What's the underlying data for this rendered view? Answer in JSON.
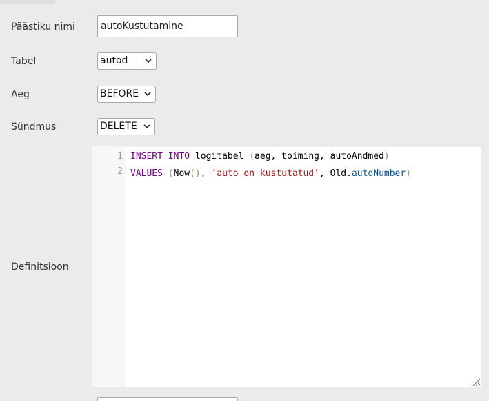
{
  "form": {
    "name_label": "Päästiku nimi",
    "name_value": "autoKustutamine",
    "table_label": "Tabel",
    "table_value": "autod",
    "time_label": "Aeg",
    "time_value": "BEFORE",
    "event_label": "Sündmus",
    "event_value": "DELETE",
    "definition_label": "Definitsioon"
  },
  "editor": {
    "line_numbers": [
      "1",
      "2"
    ],
    "line1": {
      "kw1": "INSERT",
      "kw2": "INTO",
      "table": "logitabel",
      "open": "(",
      "cols": "aeg, toiming, autoAndmed",
      "close": ")"
    },
    "line2": {
      "kw": "VALUES",
      "open": "(",
      "fn": "Now",
      "fn_parens": "()",
      "comma1": ", ",
      "str": "'auto on kustutatud'",
      "comma2": ", ",
      "obj": "Old",
      "dot": ".",
      "prop": "autoNumber",
      "close": ")"
    }
  },
  "icons": {
    "select_arrow": "chevron-down-icon",
    "resize_handle": "resize-grip-icon"
  }
}
